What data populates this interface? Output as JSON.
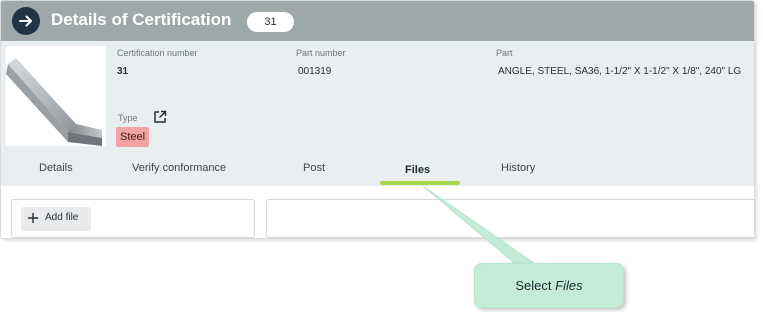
{
  "header": {
    "title": "Details of Certification",
    "count_badge": "31",
    "back_icon": "arrow-right-icon",
    "background_color": "#9ea8a8"
  },
  "details": {
    "certification_number_label": "Certification number",
    "certification_number": "31",
    "part_number_label": "Part number",
    "part_number": "001319",
    "part_label": "Part",
    "part_value": "ANGLE, STEEL, SA36, 1-1/2\" X 1-1/2\" X 1/8\", 240\" LG",
    "type_label": "Type",
    "type_value": "Steel",
    "type_color": "#f2a3a3",
    "external_link_icon": "external-link-icon"
  },
  "tabs": [
    {
      "label": "Details",
      "active": false
    },
    {
      "label": "Verify conformance",
      "active": false
    },
    {
      "label": "Post",
      "active": false
    },
    {
      "label": "Files",
      "active": true
    },
    {
      "label": "History",
      "active": false
    }
  ],
  "files": {
    "add_file_label": "Add file",
    "add_icon": "plus-icon"
  },
  "callout": {
    "prefix": "Select ",
    "emphasis": "Files",
    "color": "#c3ecd8"
  },
  "accent_color": "#a7d84c"
}
